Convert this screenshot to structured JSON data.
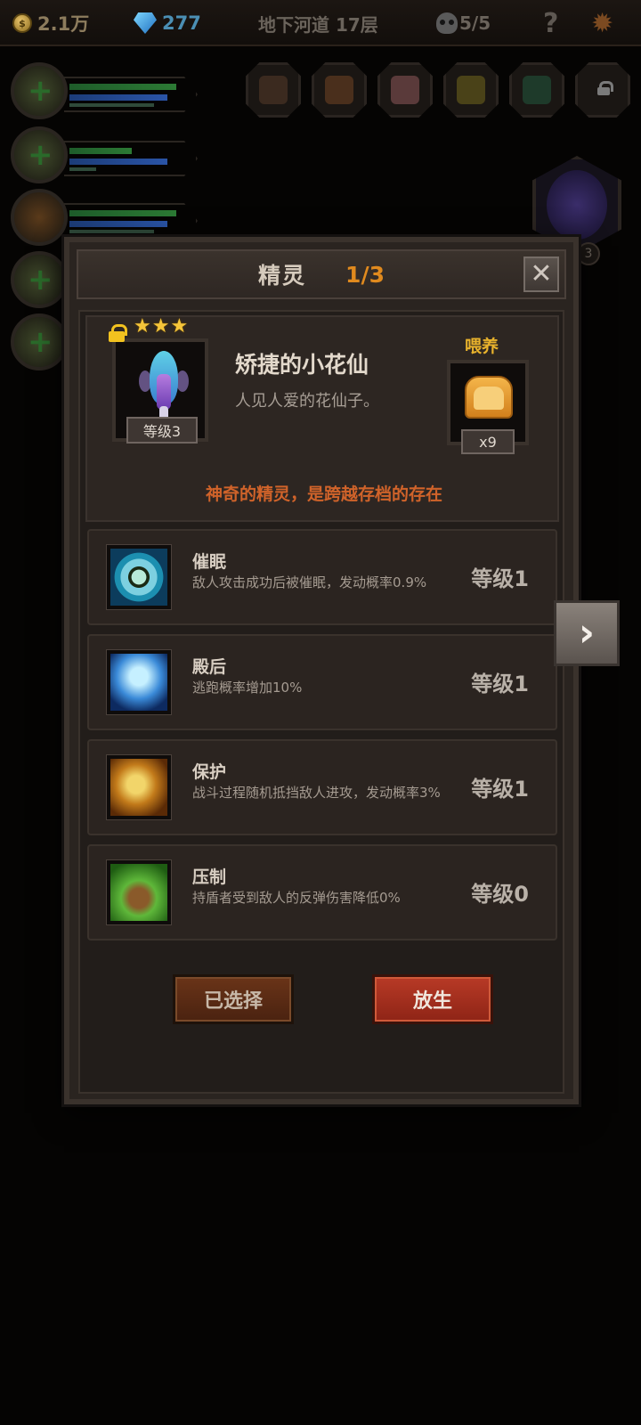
{
  "topbar": {
    "coins": "2.1万",
    "gems": "277",
    "location": "地下河道 17层",
    "kills": "5/5",
    "help_label": "?"
  },
  "dialog": {
    "title": "精灵",
    "page": "1/3",
    "close_label": "✕",
    "fairy": {
      "name": "矫捷的小花仙",
      "description": "人见人爱的花仙子。",
      "stars": 3,
      "level": "等级3",
      "note": "神奇的精灵，是跨越存档的存在"
    },
    "feed": {
      "label": "喂养",
      "item_icon": "bread-icon",
      "count": "x9"
    },
    "skills": [
      {
        "name": "催眠",
        "desc": "敌人攻击成功后被催眠，发动概率0.9%",
        "level": "等级1",
        "icon": "eye-icon"
      },
      {
        "name": "殿后",
        "desc": "逃跑概率增加10%",
        "level": "等级1",
        "icon": "wings-icon"
      },
      {
        "name": "保护",
        "desc": "战斗过程随机抵挡敌人进攻，发动概率3%",
        "level": "等级1",
        "icon": "protect-icon"
      },
      {
        "name": "压制",
        "desc": "持盾者受到敌人的反弹伤害降低0%",
        "level": "等级0",
        "icon": "claw-icon"
      }
    ],
    "buttons": {
      "selected": "已选择",
      "release": "放生"
    }
  },
  "background": {
    "fairy_badge": "3"
  },
  "colors": {
    "accent_orange": "#e08a1e",
    "note_red": "#d0632a",
    "feed_gold": "#e8b22c",
    "button_red": "#b83a26"
  }
}
